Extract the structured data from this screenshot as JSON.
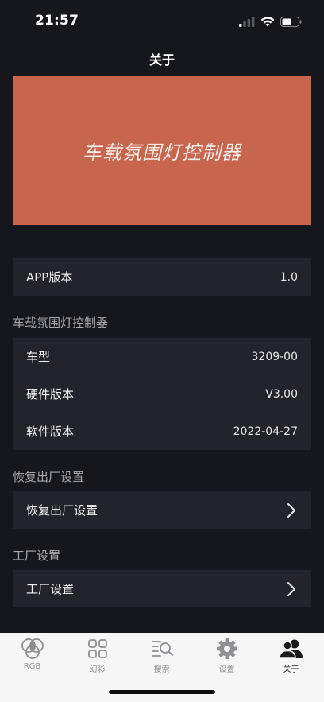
{
  "status": {
    "time": "21:57"
  },
  "nav": {
    "title": "关于"
  },
  "banner": {
    "text": "车载氛围灯控制器"
  },
  "app_section": {
    "rows": [
      {
        "label": "APP版本",
        "value": "1.0"
      }
    ]
  },
  "controller_section": {
    "header": "车载氛围灯控制器",
    "rows": [
      {
        "label": "车型",
        "value": "3209-00"
      },
      {
        "label": "硬件版本",
        "value": "V3.00"
      },
      {
        "label": "软件版本",
        "value": "2022-04-27"
      }
    ]
  },
  "restore_section": {
    "header": "恢复出厂设置",
    "row_label": "恢复出厂设置"
  },
  "factory_section": {
    "header": "工厂设置",
    "row_label": "工厂设置"
  },
  "tabs": [
    {
      "label": "RGB",
      "icon": "rgb-icon"
    },
    {
      "label": "幻彩",
      "icon": "grid-icon"
    },
    {
      "label": "搜索",
      "icon": "search-icon"
    },
    {
      "label": "设置",
      "icon": "gear-icon"
    },
    {
      "label": "关于",
      "icon": "people-icon"
    }
  ],
  "colors": {
    "background": "#16171d",
    "card": "#23242b",
    "banner": "#c8654d",
    "tab_bar": "#f6f6f6"
  }
}
